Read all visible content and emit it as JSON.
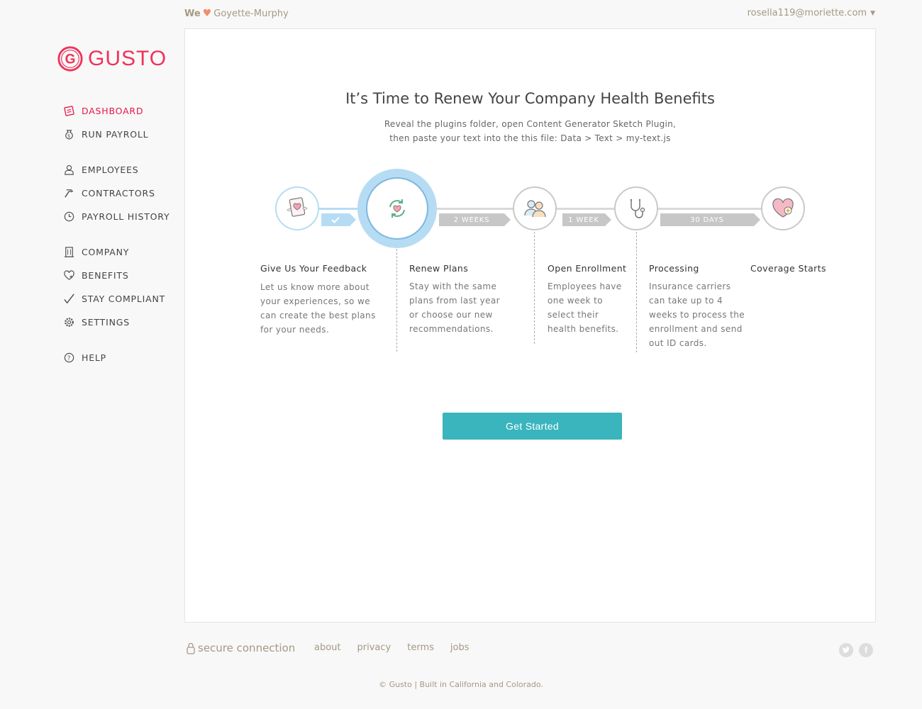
{
  "brand": {
    "name": "GUSTO",
    "color": "#f0325a"
  },
  "topbar": {
    "we": "We",
    "company": "Goyette-Murphy",
    "user_email": "rosella119@moriette.com"
  },
  "nav": {
    "dashboard": "DASHBOARD",
    "run_payroll": "RUN PAYROLL",
    "employees": "EMPLOYEES",
    "contractors": "CONTRACTORS",
    "payroll_history": "PAYROLL HISTORY",
    "company": "COMPANY",
    "benefits": "BENEFITS",
    "stay_compliant": "STAY COMPLIANT",
    "settings": "SETTINGS",
    "help": "HELP"
  },
  "main": {
    "title": "It’s Time to Renew Your Company Health Benefits",
    "subtitle_line1": "Reveal the plugins folder, open Content Generator Sketch Plugin,",
    "subtitle_line2": "then paste your text into the this file: Data > Text > my-text.js",
    "tags": {
      "weeks2": "2 WEEKS",
      "week1": "1 WEEK",
      "days30": "30 DAYS"
    },
    "steps": [
      {
        "title": "Give Us Your Feedback",
        "desc": [
          "Let us know more about",
          "your experiences, so we",
          "can create the best plans",
          "for your needs."
        ]
      },
      {
        "title": "Renew Plans",
        "desc": [
          "Stay with the same",
          "plans from last year",
          "or choose our new",
          "recommendations."
        ]
      },
      {
        "title": "Open Enrollment",
        "desc": [
          "Employees have",
          "one week to",
          "select their",
          "health benefits."
        ]
      },
      {
        "title": "Processing",
        "desc": [
          "Insurance carriers",
          "can take up to 4",
          "weeks to process the",
          "enrollment and send",
          "out ID cards."
        ]
      },
      {
        "title": "Coverage Starts",
        "desc": []
      }
    ],
    "cta_label": "Get Started"
  },
  "footer": {
    "secure": "secure connection",
    "links": [
      "about",
      "privacy",
      "terms",
      "jobs"
    ],
    "copyright": "© Gusto | Built in California and Colorado."
  },
  "colors": {
    "accent": "#3ab5bd",
    "active_nav": "#e5164a",
    "timeline_blue": "#b6dcf3",
    "muted": "#a49a84"
  }
}
